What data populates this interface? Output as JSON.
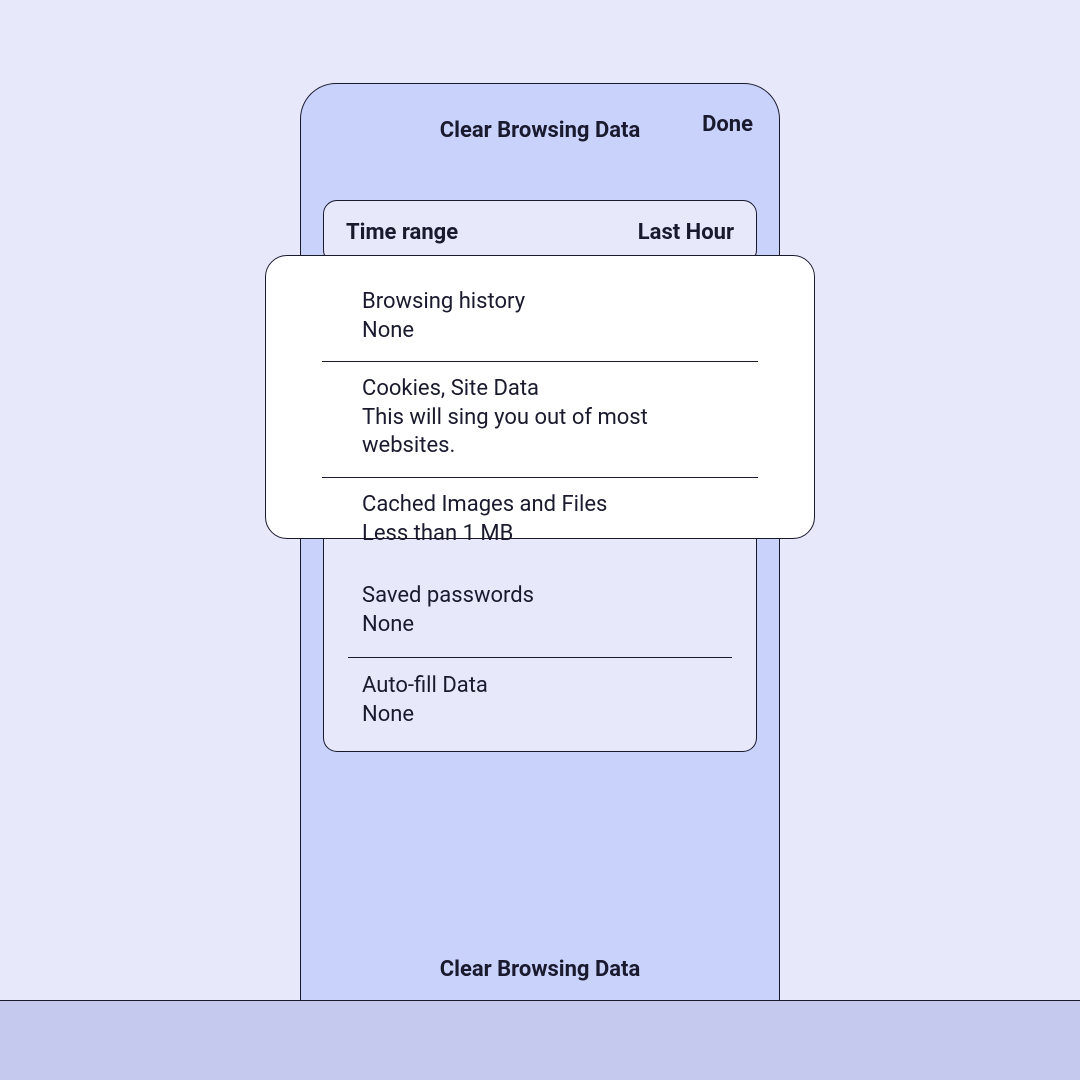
{
  "header": {
    "title": "Clear Browsing Data",
    "done_label": "Done"
  },
  "time_range": {
    "label": "Time range",
    "value": "Last Hour"
  },
  "popover_options": [
    {
      "title": "Browsing history",
      "subtitle": "None"
    },
    {
      "title": "Cookies, Site Data",
      "subtitle": "This will sing you out of most websites."
    },
    {
      "title": "Cached Images and Files",
      "subtitle": "Less than 1 MB"
    }
  ],
  "list_options": [
    {
      "title": "Saved passwords",
      "subtitle": "None"
    },
    {
      "title": "Auto-fill Data",
      "subtitle": "None"
    }
  ],
  "footer": {
    "clear_label": "Clear Browsing Data"
  }
}
